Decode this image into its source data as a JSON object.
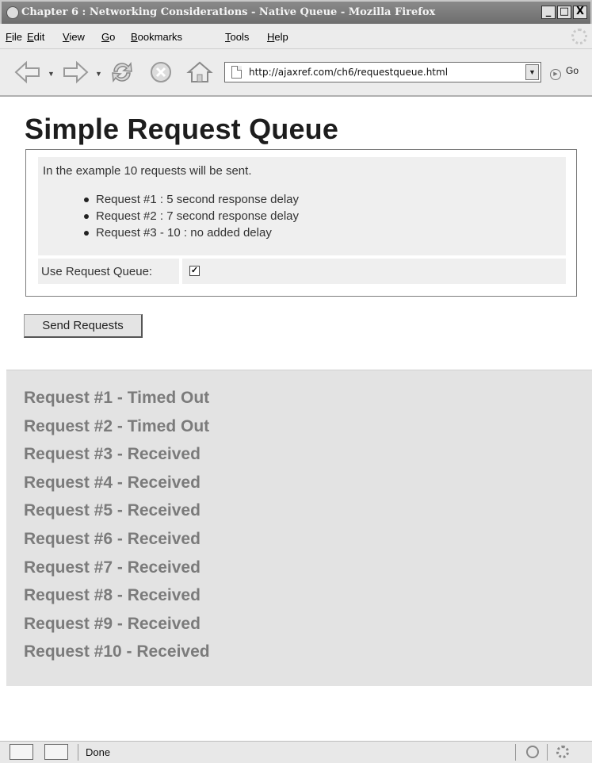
{
  "window": {
    "title": "Chapter 6 : Networking Considerations - Native Queue - Mozilla Firefox",
    "controls": [
      "_",
      "□",
      "X"
    ]
  },
  "menubar": {
    "items": [
      {
        "accel": "F",
        "rest": "ile"
      },
      {
        "accel": "E",
        "rest": "dit"
      },
      {
        "accel": "V",
        "rest": "iew"
      },
      {
        "accel": "G",
        "rest": "o"
      },
      {
        "accel": "B",
        "rest": "ookmarks"
      },
      {
        "accel": "T",
        "rest": "ools"
      },
      {
        "accel": "H",
        "rest": "elp"
      }
    ]
  },
  "navbar": {
    "url": "http://ajaxref.com/ch6/requestqueue.html",
    "go_label": "Go"
  },
  "page": {
    "title": "Simple Request Queue",
    "intro": "In the example 10 requests will be sent.",
    "delays": [
      "Request #1 : 5 second response delay",
      "Request #2 : 7 second response delay",
      "Request #3 - 10 : no added delay"
    ],
    "queue_label": "Use Request Queue:",
    "queue_checked": true,
    "send_button": "Send Requests",
    "responses": [
      "Request #1 - Timed Out",
      "Request #2 - Timed Out",
      "Request #3 - Received",
      "Request #4 - Received",
      "Request #5 - Received",
      "Request #6 - Received",
      "Request #7 - Received",
      "Request #8 - Received",
      "Request #9 - Received",
      "Request #10 - Received"
    ]
  },
  "statusbar": {
    "text": "Done"
  },
  "colors": {
    "response_text": "#7b7b7b",
    "response_bg": "#e3e3e3",
    "title_bar": "#7a7a7a"
  }
}
